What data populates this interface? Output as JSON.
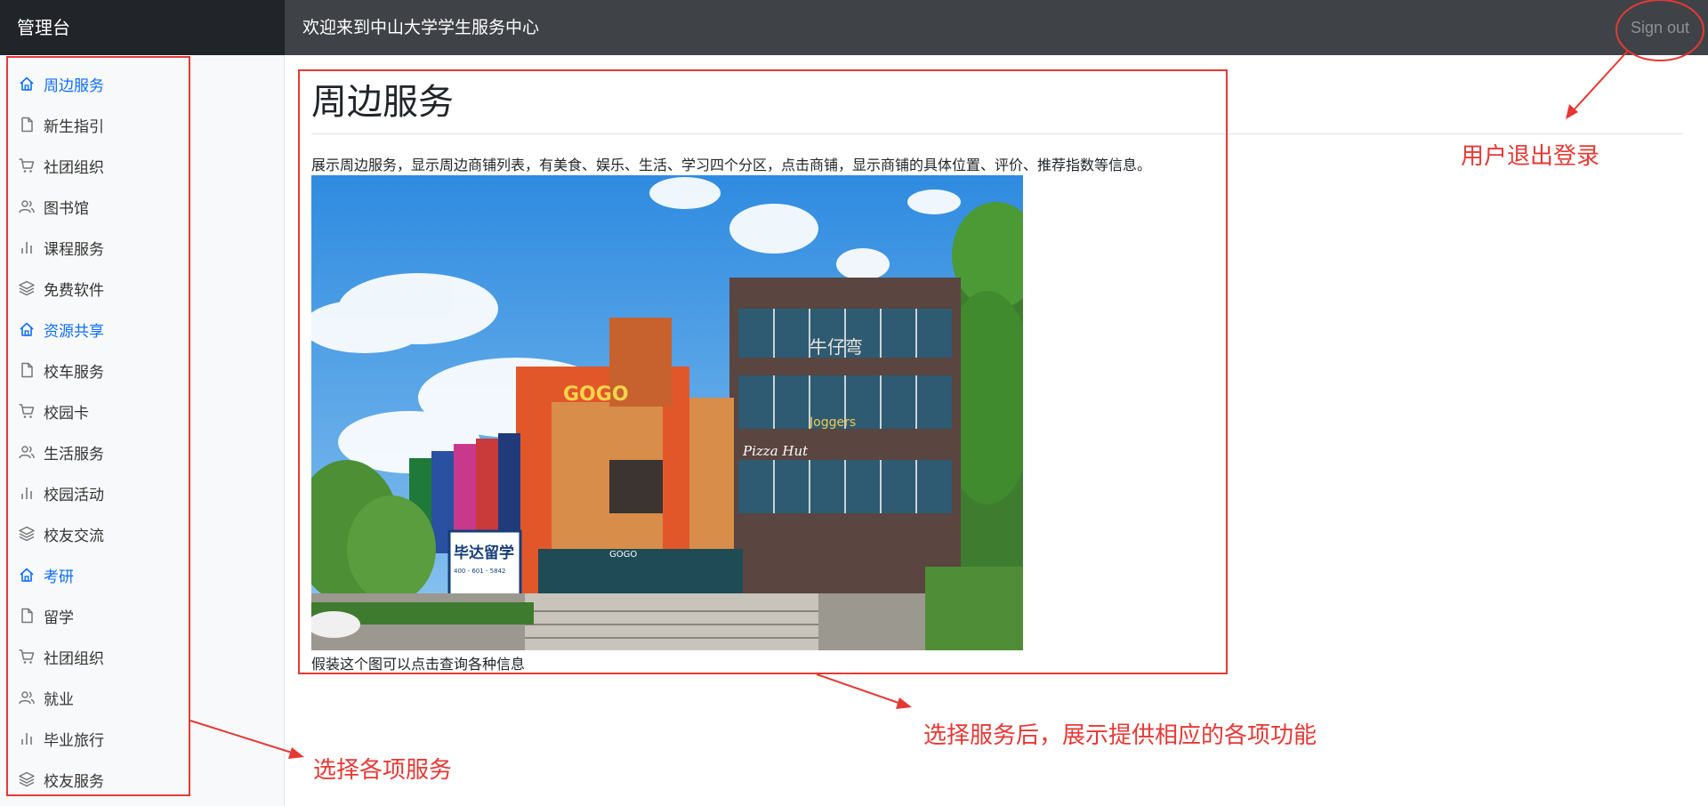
{
  "header": {
    "brand": "管理台",
    "welcome": "欢迎来到中山大学学生服务中心",
    "sign_out": "Sign out"
  },
  "sidebar": {
    "items": [
      {
        "label": "周边服务",
        "icon": "home-icon",
        "active": true
      },
      {
        "label": "新生指引",
        "icon": "file-icon",
        "active": false
      },
      {
        "label": "社团组织",
        "icon": "cart-icon",
        "active": false
      },
      {
        "label": "图书馆",
        "icon": "users-icon",
        "active": false
      },
      {
        "label": "课程服务",
        "icon": "bar-chart-icon",
        "active": false
      },
      {
        "label": "免费软件",
        "icon": "layers-icon",
        "active": false
      },
      {
        "label": "资源共享",
        "icon": "home-icon",
        "active": true
      },
      {
        "label": "校车服务",
        "icon": "file-icon",
        "active": false
      },
      {
        "label": "校园卡",
        "icon": "cart-icon",
        "active": false
      },
      {
        "label": "生活服务",
        "icon": "users-icon",
        "active": false
      },
      {
        "label": "校园活动",
        "icon": "bar-chart-icon",
        "active": false
      },
      {
        "label": "校友交流",
        "icon": "layers-icon",
        "active": false
      },
      {
        "label": "考研",
        "icon": "home-icon",
        "active": true
      },
      {
        "label": "留学",
        "icon": "file-icon",
        "active": false
      },
      {
        "label": "社团组织",
        "icon": "cart-icon",
        "active": false
      },
      {
        "label": "就业",
        "icon": "users-icon",
        "active": false
      },
      {
        "label": "毕业旅行",
        "icon": "bar-chart-icon",
        "active": false
      },
      {
        "label": "校友服务",
        "icon": "layers-icon",
        "active": false
      }
    ]
  },
  "main": {
    "title": "周边服务",
    "description": "展示周边服务，显示周边商铺列表，有美食、娱乐、生活、学习四个分区，点击商铺，显示商铺的具体位置、评价、推荐指数等信息。",
    "image_caption": "假装这个图可以点击查询各种信息",
    "photo": {
      "mall_sign": "GOGO",
      "banner_sign": "毕达留学",
      "banner_phone": "400 - 601 - 5842",
      "restaurant": "Pizza Hut",
      "building_sign": "牛仔弯",
      "entrance_sign": "GOGO",
      "store_sign": "Joggers"
    }
  },
  "annotations": {
    "logout_note": "用户退出登录",
    "content_note": "选择服务后，展示提供相应的各项功能",
    "sidebar_note": "选择各项服务"
  },
  "colors": {
    "topbar": "#212529",
    "topbar_right": "#3f4347",
    "active_link": "#0d6efd",
    "annotation": "#e53935"
  }
}
